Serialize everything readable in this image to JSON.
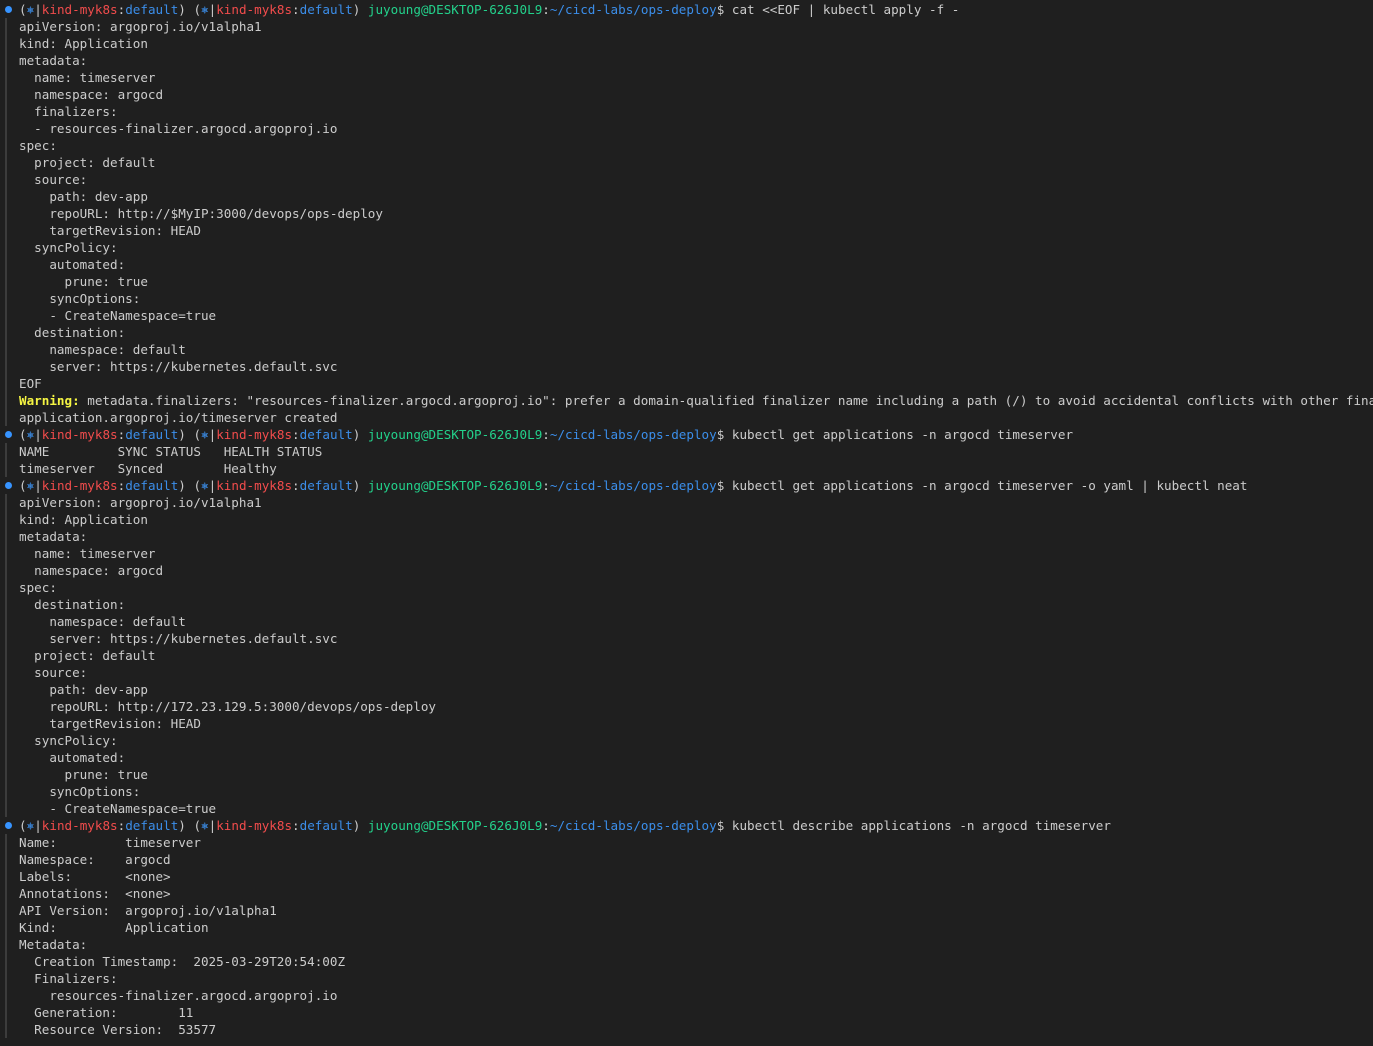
{
  "prompt": {
    "k8s_glyph": "⎈",
    "context": "kind-myk8s",
    "namespace": "default",
    "user_host": "juyoung@DESKTOP-626J0L9",
    "path": "~/cicd-labs/ops-deploy"
  },
  "colors": {
    "background": "#1f1f1f",
    "foreground": "#cccccc",
    "context": "#f14c4c",
    "namespace": "#3b8eea",
    "user_host": "#23d18b",
    "path": "#3b8eea",
    "warning": "#f5f543",
    "status_dot": "#3794ff"
  },
  "lines": [
    {
      "type": "prompt",
      "cmd": "cat <<EOF | kubectl apply -f -"
    },
    {
      "type": "out",
      "text": "apiVersion: argoproj.io/v1alpha1"
    },
    {
      "type": "out",
      "text": "kind: Application"
    },
    {
      "type": "out",
      "text": "metadata:"
    },
    {
      "type": "out",
      "text": "  name: timeserver"
    },
    {
      "type": "out",
      "text": "  namespace: argocd"
    },
    {
      "type": "out",
      "text": "  finalizers:"
    },
    {
      "type": "out",
      "text": "  - resources-finalizer.argocd.argoproj.io"
    },
    {
      "type": "out",
      "text": "spec:"
    },
    {
      "type": "out",
      "text": "  project: default"
    },
    {
      "type": "out",
      "text": "  source:"
    },
    {
      "type": "out",
      "text": "    path: dev-app"
    },
    {
      "type": "out",
      "text": "    repoURL: http://$MyIP:3000/devops/ops-deploy"
    },
    {
      "type": "out",
      "text": "    targetRevision: HEAD"
    },
    {
      "type": "out",
      "text": "  syncPolicy:"
    },
    {
      "type": "out",
      "text": "    automated:"
    },
    {
      "type": "out",
      "text": "      prune: true"
    },
    {
      "type": "out",
      "text": "    syncOptions:"
    },
    {
      "type": "out",
      "text": "    - CreateNamespace=true"
    },
    {
      "type": "out",
      "text": "  destination:"
    },
    {
      "type": "out",
      "text": "    namespace: default"
    },
    {
      "type": "out",
      "text": "    server: https://kubernetes.default.svc"
    },
    {
      "type": "out",
      "text": "EOF"
    },
    {
      "type": "warn",
      "label": "Warning:",
      "text": " metadata.finalizers: \"resources-finalizer.argocd.argoproj.io\": prefer a domain-qualified finalizer name including a path (/) to avoid accidental conflicts with other finalizer writers"
    },
    {
      "type": "out",
      "text": "application.argoproj.io/timeserver created"
    },
    {
      "type": "prompt",
      "cmd": "kubectl get applications -n argocd timeserver"
    },
    {
      "type": "out",
      "text": "NAME         SYNC STATUS   HEALTH STATUS"
    },
    {
      "type": "out",
      "text": "timeserver   Synced        Healthy"
    },
    {
      "type": "prompt",
      "cmd": "kubectl get applications -n argocd timeserver -o yaml | kubectl neat"
    },
    {
      "type": "out",
      "text": "apiVersion: argoproj.io/v1alpha1"
    },
    {
      "type": "out",
      "text": "kind: Application"
    },
    {
      "type": "out",
      "text": "metadata:"
    },
    {
      "type": "out",
      "text": "  name: timeserver"
    },
    {
      "type": "out",
      "text": "  namespace: argocd"
    },
    {
      "type": "out",
      "text": "spec:"
    },
    {
      "type": "out",
      "text": "  destination:"
    },
    {
      "type": "out",
      "text": "    namespace: default"
    },
    {
      "type": "out",
      "text": "    server: https://kubernetes.default.svc"
    },
    {
      "type": "out",
      "text": "  project: default"
    },
    {
      "type": "out",
      "text": "  source:"
    },
    {
      "type": "out",
      "text": "    path: dev-app"
    },
    {
      "type": "out",
      "text": "    repoURL: http://172.23.129.5:3000/devops/ops-deploy"
    },
    {
      "type": "out",
      "text": "    targetRevision: HEAD"
    },
    {
      "type": "out",
      "text": "  syncPolicy:"
    },
    {
      "type": "out",
      "text": "    automated:"
    },
    {
      "type": "out",
      "text": "      prune: true"
    },
    {
      "type": "out",
      "text": "    syncOptions:"
    },
    {
      "type": "out",
      "text": "    - CreateNamespace=true"
    },
    {
      "type": "prompt",
      "cmd": "kubectl describe applications -n argocd timeserver"
    },
    {
      "type": "out",
      "text": "Name:         timeserver"
    },
    {
      "type": "out",
      "text": "Namespace:    argocd"
    },
    {
      "type": "out",
      "text": "Labels:       <none>"
    },
    {
      "type": "out",
      "text": "Annotations:  <none>"
    },
    {
      "type": "out",
      "text": "API Version:  argoproj.io/v1alpha1"
    },
    {
      "type": "out",
      "text": "Kind:         Application"
    },
    {
      "type": "out",
      "text": "Metadata:"
    },
    {
      "type": "out",
      "text": "  Creation Timestamp:  2025-03-29T20:54:00Z"
    },
    {
      "type": "out",
      "text": "  Finalizers:"
    },
    {
      "type": "out",
      "text": "    resources-finalizer.argocd.argoproj.io"
    },
    {
      "type": "out",
      "text": "  Generation:        11"
    },
    {
      "type": "out",
      "text": "  Resource Version:  53577"
    }
  ]
}
